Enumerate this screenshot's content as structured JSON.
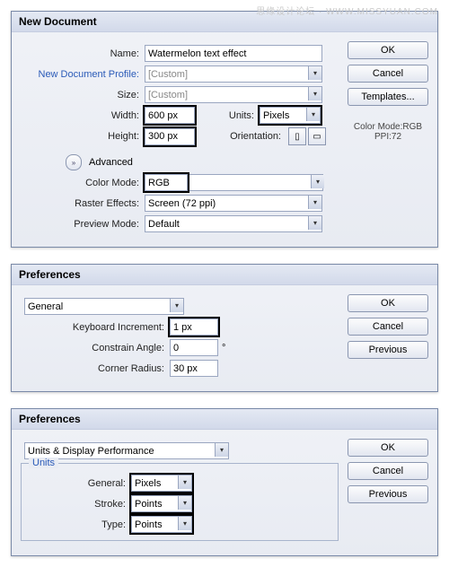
{
  "watermark": "思缘设计论坛 · WWW.MISSYUAN.COM",
  "dialog1": {
    "title": "New Document",
    "labels": {
      "name": "Name:",
      "profile": "New Document Profile:",
      "size": "Size:",
      "width": "Width:",
      "height": "Height:",
      "units": "Units:",
      "orientation": "Orientation:",
      "advanced": "Advanced",
      "color_mode": "Color Mode:",
      "raster": "Raster Effects:",
      "preview": "Preview Mode:"
    },
    "values": {
      "name": "Watermelon text effect",
      "profile": "[Custom]",
      "size": "[Custom]",
      "width": "600 px",
      "height": "300 px",
      "units": "Pixels",
      "color_mode": "RGB",
      "raster": "Screen (72 ppi)",
      "preview": "Default"
    },
    "info1": "Color Mode:RGB",
    "info2": "PPI:72",
    "buttons": {
      "ok": "OK",
      "cancel": "Cancel",
      "templates": "Templates..."
    }
  },
  "dialog2": {
    "title": "Preferences",
    "tab": "General",
    "labels": {
      "kbd": "Keyboard Increment:",
      "angle": "Constrain Angle:",
      "radius": "Corner Radius:"
    },
    "values": {
      "kbd": "1 px",
      "angle": "0",
      "radius": "30 px"
    },
    "degree": "°",
    "buttons": {
      "ok": "OK",
      "cancel": "Cancel",
      "prev": "Previous"
    }
  },
  "dialog3": {
    "title": "Preferences",
    "tab": "Units & Display Performance",
    "group": "Units",
    "labels": {
      "general": "General:",
      "stroke": "Stroke:",
      "type": "Type:"
    },
    "values": {
      "general": "Pixels",
      "stroke": "Points",
      "type": "Points"
    },
    "buttons": {
      "ok": "OK",
      "cancel": "Cancel",
      "prev": "Previous"
    }
  }
}
